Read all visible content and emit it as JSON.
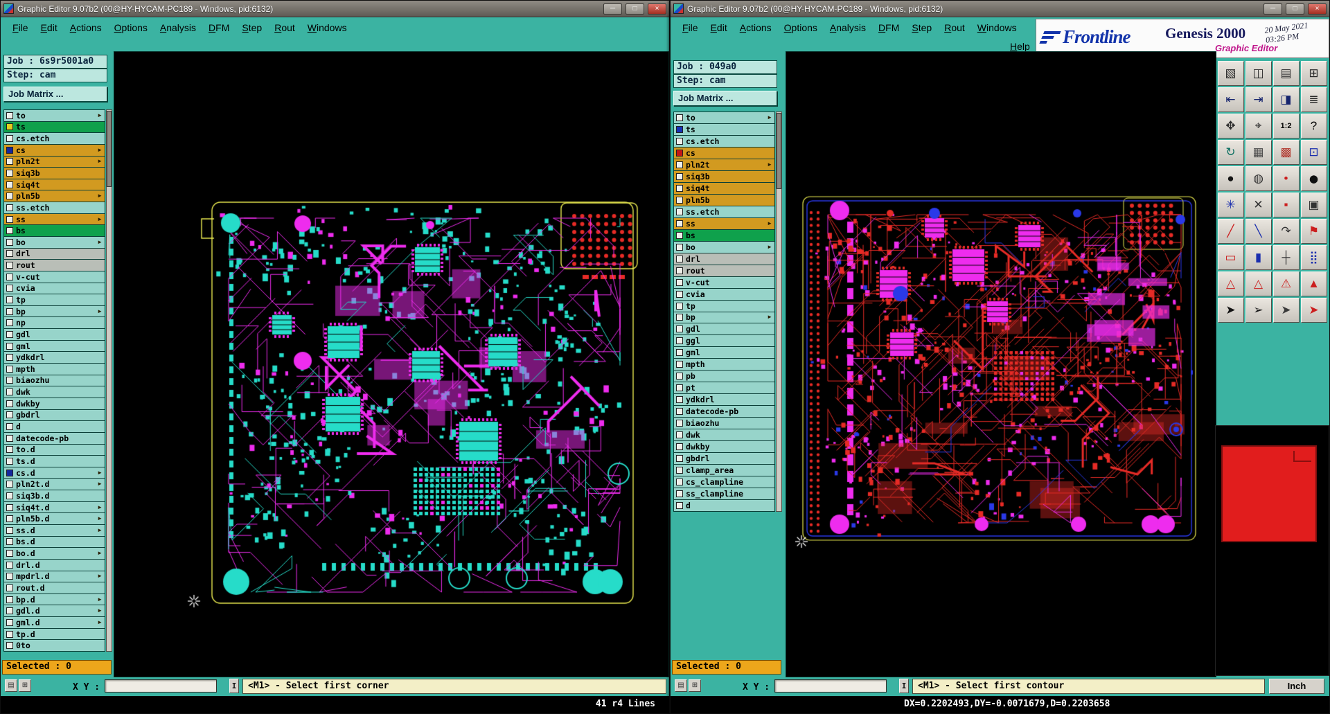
{
  "chrome": {
    "minimize": "─",
    "maximize": "□",
    "close": "×"
  },
  "colors": {
    "pale": "#97d4ca",
    "orange": "#d29a20",
    "green": "#0fa14c",
    "gray": "#b9beb7",
    "teal": "#31a091"
  },
  "pcb": {
    "cyan": "#26dcc9",
    "magenta": "#ee2cee",
    "red": "#e62b26",
    "blue": "#2a39e8",
    "yellow": "#ecec50",
    "white": "#ffffff"
  },
  "command": {
    "xy_label": "X Y :",
    "xy_value": "",
    "separator": "I",
    "icons": [
      {
        "name": "notes-button",
        "glyph": "▤"
      },
      {
        "name": "snap-grid-button",
        "glyph": "⊞"
      }
    ]
  },
  "logo": {
    "brand": "Frontline",
    "product": "Genesis 2000",
    "date": "20 May 2021",
    "time": "03:26 PM",
    "subtitle": "Graphic Editor"
  },
  "left_window": {
    "title": "Graphic Editor 9.07b2 (00@HY-HYCAM-PC189 - Windows, pid:6132)",
    "menu": [
      "File",
      "Edit",
      "Actions",
      "Options",
      "Analysis",
      "DFM",
      "Step",
      "Rout",
      "Windows"
    ],
    "job": "Job : 6s9r5001a0",
    "step": "Step: cam",
    "job_matrix": "Job Matrix ...",
    "selected": "Selected : 0",
    "prompt": "<M1> - Select first corner",
    "status": "41 r4 Lines",
    "layers": [
      {
        "name": "to",
        "color": "pale",
        "arrow": true
      },
      {
        "name": "ts",
        "color": "green",
        "ind": "#e3cf1d"
      },
      {
        "name": "cs.etch",
        "color": "pale"
      },
      {
        "name": "cs",
        "color": "orange",
        "arrow": true,
        "ind": "#15279e"
      },
      {
        "name": "pln2t",
        "color": "orange",
        "arrow": true
      },
      {
        "name": "siq3b",
        "color": "orange"
      },
      {
        "name": "siq4t",
        "color": "orange"
      },
      {
        "name": "pln5b",
        "color": "orange",
        "arrow": true
      },
      {
        "name": "ss.etch",
        "color": "pale"
      },
      {
        "name": "ss",
        "color": "orange",
        "arrow": true
      },
      {
        "name": "bs",
        "color": "green"
      },
      {
        "name": "bo",
        "color": "pale",
        "arrow": true
      },
      {
        "name": "drl",
        "color": "gray"
      },
      {
        "name": "rout",
        "color": "gray"
      },
      {
        "name": "v-cut",
        "color": "pale"
      },
      {
        "name": "cvia",
        "color": "pale"
      },
      {
        "name": "tp",
        "color": "pale"
      },
      {
        "name": "bp",
        "color": "pale",
        "arrow": true
      },
      {
        "name": "np",
        "color": "pale"
      },
      {
        "name": "gdl",
        "color": "pale"
      },
      {
        "name": "gml",
        "color": "pale"
      },
      {
        "name": "ydkdrl",
        "color": "pale"
      },
      {
        "name": "mpth",
        "color": "pale"
      },
      {
        "name": "biaozhu",
        "color": "pale"
      },
      {
        "name": "dwk",
        "color": "pale"
      },
      {
        "name": "dwkby",
        "color": "pale"
      },
      {
        "name": "gbdrl",
        "color": "pale"
      },
      {
        "name": "d",
        "color": "pale"
      },
      {
        "name": "datecode-pb",
        "color": "pale"
      },
      {
        "name": "to.d",
        "color": "pale"
      },
      {
        "name": "ts.d",
        "color": "pale"
      },
      {
        "name": "cs.d",
        "color": "pale",
        "arrow": true,
        "ind": "#15279e"
      },
      {
        "name": "pln2t.d",
        "color": "pale",
        "arrow": true
      },
      {
        "name": "siq3b.d",
        "color": "pale"
      },
      {
        "name": "siq4t.d",
        "color": "pale",
        "arrow": true
      },
      {
        "name": "pln5b.d",
        "color": "pale",
        "arrow": true
      },
      {
        "name": "ss.d",
        "color": "pale",
        "arrow": true
      },
      {
        "name": "bs.d",
        "color": "pale"
      },
      {
        "name": "bo.d",
        "color": "pale",
        "arrow": true
      },
      {
        "name": "drl.d",
        "color": "pale"
      },
      {
        "name": "mpdrl.d",
        "color": "pale",
        "arrow": true
      },
      {
        "name": "rout.d",
        "color": "pale"
      },
      {
        "name": "bp.d",
        "color": "pale",
        "arrow": true
      },
      {
        "name": "gdl.d",
        "color": "pale",
        "arrow": true
      },
      {
        "name": "gml.d",
        "color": "pale",
        "arrow": true
      },
      {
        "name": "tp.d",
        "color": "pale"
      },
      {
        "name": "0to",
        "color": "pale"
      }
    ]
  },
  "right_window": {
    "title": "Graphic Editor 9.07b2 (00@HY-HYCAM-PC189 - Windows, pid:6132)",
    "menu": [
      "File",
      "Edit",
      "Actions",
      "Options",
      "Analysis",
      "DFM",
      "Step",
      "Rout",
      "Windows"
    ],
    "help": "Help",
    "job": "Job : 049a0",
    "step": "Step: cam",
    "job_matrix": "Job Matrix ...",
    "selected": "Selected : 0",
    "prompt": "<M1> - Select first contour",
    "unit": "Inch",
    "status": "DX=0.2202493,DY=-0.0071679,D=0.2203658",
    "layers": [
      {
        "name": "to",
        "color": "pale",
        "arrow": true
      },
      {
        "name": "ts",
        "color": "pale",
        "ind": "#1630b6"
      },
      {
        "name": "cs.etch",
        "color": "pale"
      },
      {
        "name": "cs",
        "color": "orange",
        "ind": "#c41616"
      },
      {
        "name": "pln2t",
        "color": "orange",
        "arrow": true
      },
      {
        "name": "siq3b",
        "color": "orange"
      },
      {
        "name": "siq4t",
        "color": "orange"
      },
      {
        "name": "pln5b",
        "color": "orange"
      },
      {
        "name": "ss.etch",
        "color": "pale"
      },
      {
        "name": "ss",
        "color": "orange",
        "arrow": true
      },
      {
        "name": "bs",
        "color": "green"
      },
      {
        "name": "bo",
        "color": "pale",
        "arrow": true
      },
      {
        "name": "drl",
        "color": "gray"
      },
      {
        "name": "rout",
        "color": "gray"
      },
      {
        "name": "v-cut",
        "color": "pale"
      },
      {
        "name": "cvia",
        "color": "pale"
      },
      {
        "name": "tp",
        "color": "pale"
      },
      {
        "name": "bp",
        "color": "pale",
        "arrow": true
      },
      {
        "name": "gdl",
        "color": "pale"
      },
      {
        "name": "ggl",
        "color": "pale"
      },
      {
        "name": "gml",
        "color": "pale"
      },
      {
        "name": "mpth",
        "color": "pale"
      },
      {
        "name": "pb",
        "color": "pale"
      },
      {
        "name": "pt",
        "color": "pale"
      },
      {
        "name": "ydkdrl",
        "color": "pale"
      },
      {
        "name": "datecode-pb",
        "color": "pale"
      },
      {
        "name": "biaozhu",
        "color": "pale"
      },
      {
        "name": "dwk",
        "color": "pale"
      },
      {
        "name": "dwkby",
        "color": "pale"
      },
      {
        "name": "gbdrl",
        "color": "pale"
      },
      {
        "name": "clamp_area",
        "color": "pale"
      },
      {
        "name": "cs_clampline",
        "color": "pale"
      },
      {
        "name": "ss_clampline",
        "color": "pale"
      },
      {
        "name": "d",
        "color": "pale"
      }
    ]
  },
  "toolbar": {
    "buttons": [
      {
        "name": "new-window-icon",
        "glyph": "▧",
        "color": "#2b2b2b"
      },
      {
        "name": "window-pair-icon",
        "glyph": "◫",
        "color": "#2b2b2b"
      },
      {
        "name": "window-rows-icon",
        "glyph": "▤",
        "color": "#2b2b2b"
      },
      {
        "name": "window-grid-icon",
        "glyph": "⊞",
        "color": "#2b2b2b"
      },
      {
        "name": "pan-left-icon",
        "glyph": "⇤",
        "color": "#16246e"
      },
      {
        "name": "pan-right-icon",
        "glyph": "⇥",
        "color": "#16246e"
      },
      {
        "name": "split-view-icon",
        "glyph": "◨",
        "color": "#16246e"
      },
      {
        "name": "stack-layers-icon",
        "glyph": "≣",
        "color": "#2b2b2b"
      },
      {
        "name": "pan-all-icon",
        "glyph": "✥",
        "color": "#2b2b2b"
      },
      {
        "name": "center-target-icon",
        "glyph": "⌖",
        "color": "#2b2b2b"
      },
      {
        "name": "zoom-1-2-button",
        "glyph": "1:2",
        "color": "#000000",
        "small": true
      },
      {
        "name": "help-button",
        "glyph": "?",
        "color": "#000000"
      },
      {
        "name": "redraw-icon",
        "glyph": "↻",
        "color": "#0a6e60"
      },
      {
        "name": "mesh-icon",
        "glyph": "▦",
        "color": "#4c4c4c"
      },
      {
        "name": "color-palette-icon",
        "glyph": "▩",
        "color": "#b03228"
      },
      {
        "name": "matrix-colors-icon",
        "glyph": "⊡",
        "color": "#1a2eae"
      },
      {
        "name": "filled-pad-icon",
        "glyph": "●",
        "color": "#151515"
      },
      {
        "name": "sketch-pad-icon",
        "glyph": "◍",
        "color": "#333333"
      },
      {
        "name": "red-dot-icon",
        "glyph": "•",
        "color": "#cc1f1f"
      },
      {
        "name": "solid-dot-icon",
        "glyph": "⬤",
        "color": "#101010",
        "small": true
      },
      {
        "name": "blue-star-icon",
        "glyph": "✳",
        "color": "#1a2eae"
      },
      {
        "name": "erase-icon",
        "glyph": "✕",
        "color": "#333333"
      },
      {
        "name": "red-chip-icon",
        "glyph": "▪",
        "color": "#cc1f1f"
      },
      {
        "name": "component-icon",
        "glyph": "▣",
        "color": "#333333"
      },
      {
        "name": "red-slope-icon",
        "glyph": "╱",
        "color": "#cc1f1f"
      },
      {
        "name": "blue-slope-icon",
        "glyph": "╲",
        "color": "#1a2eae"
      },
      {
        "name": "arc-tool-icon",
        "glyph": "↷",
        "color": "#333333"
      },
      {
        "name": "flag-tool-icon",
        "glyph": "⚑",
        "color": "#cc1f1f"
      },
      {
        "name": "red-frame-icon",
        "glyph": "▭",
        "color": "#cc1f1f"
      },
      {
        "name": "blue-bar-icon",
        "glyph": "▮",
        "color": "#1a2eae"
      },
      {
        "name": "crosshair-icon",
        "glyph": "┼",
        "color": "#333333"
      },
      {
        "name": "dot-matrix-icon",
        "glyph": "⣿",
        "color": "#1a2eae"
      },
      {
        "name": "warning-outline-icon",
        "glyph": "△",
        "color": "#cc1f1f"
      },
      {
        "name": "warning-outline2-icon",
        "glyph": "△",
        "color": "#cc1f1f"
      },
      {
        "name": "warning-alert-icon",
        "glyph": "⚠",
        "color": "#cc1f1f"
      },
      {
        "name": "warning-solid-icon",
        "glyph": "▲",
        "color": "#cc1f1f"
      },
      {
        "name": "select-cursor-icon",
        "glyph": "➤",
        "color": "#141414"
      },
      {
        "name": "outline-cursor-icon",
        "glyph": "➢",
        "color": "#141414"
      },
      {
        "name": "add-cursor-icon",
        "glyph": "➤",
        "color": "#3a3a3a"
      },
      {
        "name": "zoom-cursor-icon",
        "glyph": "➤",
        "color": "#cc1f1f"
      }
    ]
  }
}
